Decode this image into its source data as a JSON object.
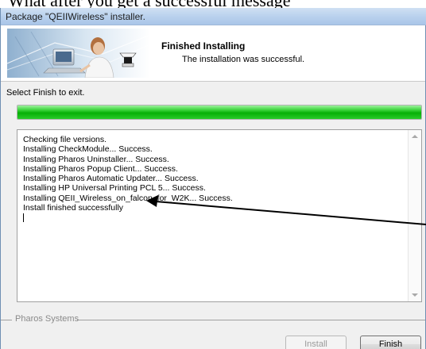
{
  "document": {
    "partial_text": "What after you get a successful message"
  },
  "window": {
    "title": "Package \"QEIIWireless\" installer."
  },
  "banner": {
    "title": "Finished Installing",
    "subtitle": "The installation was successful."
  },
  "instruction": "Select Finish to exit.",
  "progress": {
    "percent": 100,
    "color": "#0db30d"
  },
  "log": {
    "lines": [
      "Checking file versions.",
      "Installing CheckModule... Success.",
      "Installing Pharos Uninstaller... Success.",
      "Installing Pharos Popup Client... Success.",
      "Installing Pharos Automatic Updater... Success.",
      "Installing HP Universal Printing PCL 5... Success.",
      "Installing QEII_Wireless_on_falcon_for_W2K... Success.",
      "Install finished successfully"
    ]
  },
  "footer": {
    "group_label": "Pharos Systems"
  },
  "buttons": {
    "install": "Install",
    "finish": "Finish"
  },
  "icons": {
    "banner_art": "installer-banner-image",
    "scroll_up": "scroll-up-arrow-icon",
    "scroll_down": "scroll-down-arrow-icon",
    "annotation": "annotation-arrow"
  }
}
